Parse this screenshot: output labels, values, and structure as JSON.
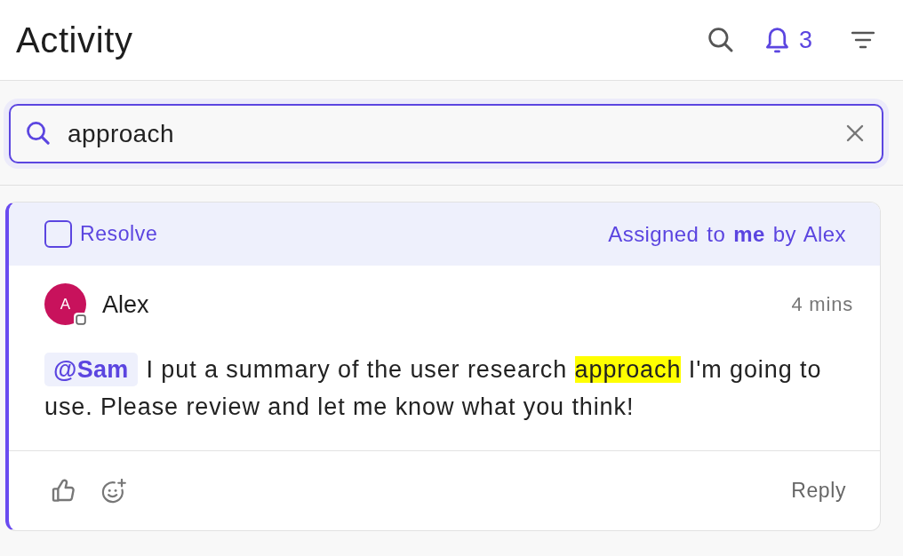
{
  "header": {
    "title": "Activity",
    "notification_count": "3"
  },
  "search": {
    "value": "approach"
  },
  "comment": {
    "resolve": {
      "label": "Resolve",
      "checked": false
    },
    "assignment": "Assigned to **me** by Alex",
    "author": {
      "name": "Alex",
      "initial": "A"
    },
    "time": "4 mins",
    "mention": "@Sam",
    "message": [
      {
        "text": "I put a summary of the user research ",
        "highlighted": false
      },
      {
        "text": "approach",
        "highlighted": true
      },
      {
        "text": " I'm going to use. Please review and let me know what you think!",
        "highlighted": false
      }
    ],
    "reply": "Reply"
  }
}
